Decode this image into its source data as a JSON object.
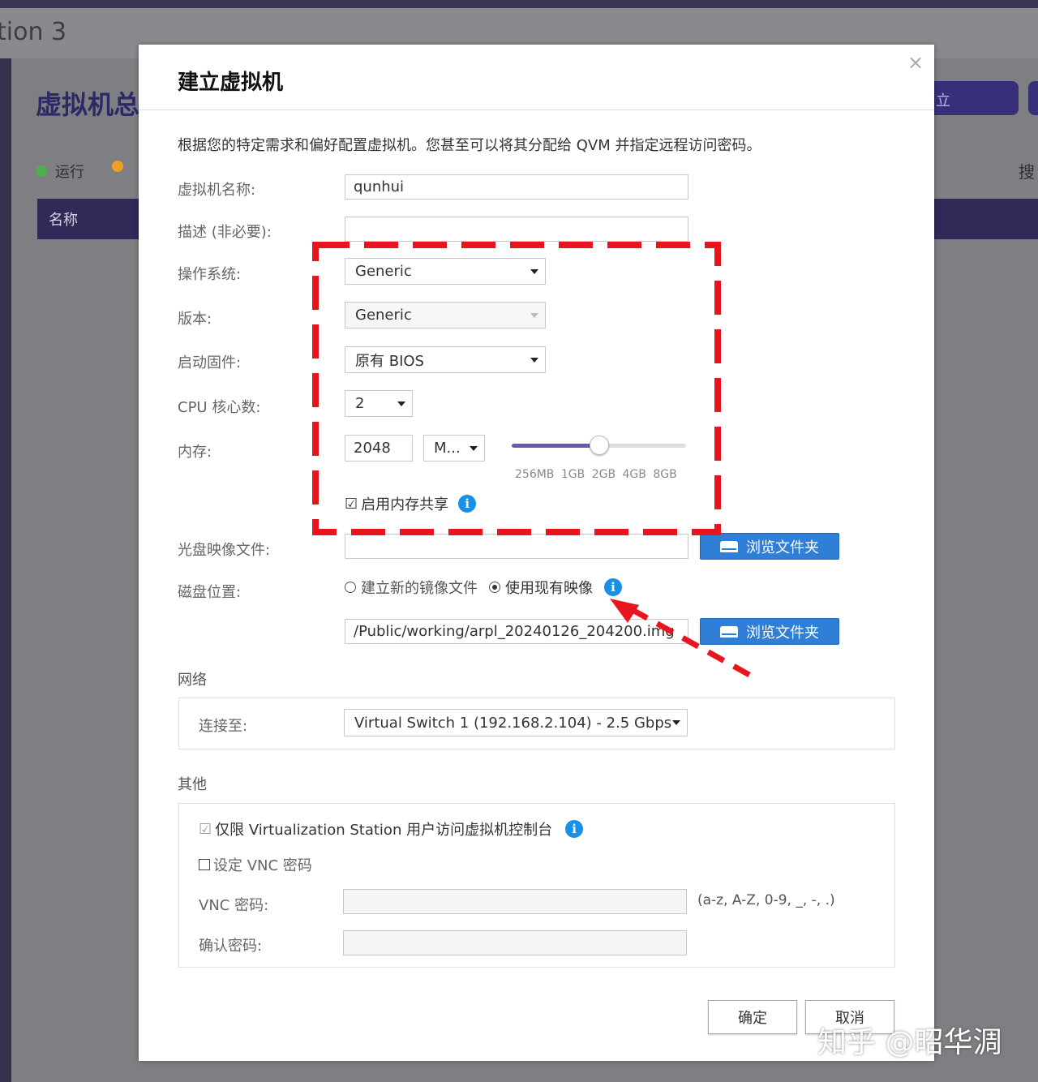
{
  "background": {
    "app_title": "tion 3",
    "page_title": "虚拟机总",
    "status_running": "运行",
    "status_second_glyph": "",
    "table_header_name": "名称",
    "right_button_label": "立",
    "search_label": "搜",
    "colors": {
      "running": "#4caf50",
      "paused": "#f0a020"
    }
  },
  "modal": {
    "title": "建立虚拟机",
    "close": "×",
    "description": "根据您的特定需求和偏好配置虚拟机。您甚至可以将其分配给 QVM 并指定远程访问密码。",
    "fields": {
      "vm_name": {
        "label": "虚拟机名称:",
        "value": "qunhui"
      },
      "description": {
        "label": "描述 (非必要):",
        "value": ""
      },
      "os": {
        "label": "操作系统:",
        "value": "Generic"
      },
      "version": {
        "label": "版本:",
        "value": "Generic"
      },
      "firmware": {
        "label": "启动固件:",
        "value": "原有 BIOS"
      },
      "cpu": {
        "label": "CPU 核心数:",
        "value": "2"
      },
      "memory": {
        "label": "内存:",
        "value": "2048",
        "unit": "M...",
        "ticks": [
          "256MB",
          "1GB",
          "2GB",
          "4GB",
          "8GB"
        ],
        "slider_fraction": 0.5
      },
      "memory_share": {
        "label": "启用内存共享",
        "checked": "☑"
      },
      "iso": {
        "label": "光盘映像文件:",
        "value": "",
        "browse": "浏览文件夹"
      },
      "disk": {
        "label": "磁盘位置:",
        "option_new": "建立新的镜像文件",
        "option_existing": "使用现有映像",
        "path": "/Public/working/arpl_20240126_204200.img",
        "browse": "浏览文件夹"
      }
    },
    "network": {
      "section": "网络",
      "connect_label": "连接至:",
      "connect_value": "Virtual Switch 1 (192.168.2.104) - 2.5 Gbps"
    },
    "other": {
      "section": "其他",
      "restrict_label": "仅限 Virtualization Station 用户访问虚拟机控制台",
      "restrict_checked": "☑",
      "set_vnc_label": "设定 VNC 密码",
      "vnc_password_label": "VNC 密码:",
      "vnc_password_hint": "(a-z, A-Z, 0-9, _, -, .)",
      "confirm_password_label": "确认密码:"
    },
    "buttons": {
      "ok": "确定",
      "cancel": "取消"
    },
    "info_glyph": "i"
  },
  "annotation": {
    "color": "#e8141e"
  },
  "watermark": "知乎 @昭华淍"
}
